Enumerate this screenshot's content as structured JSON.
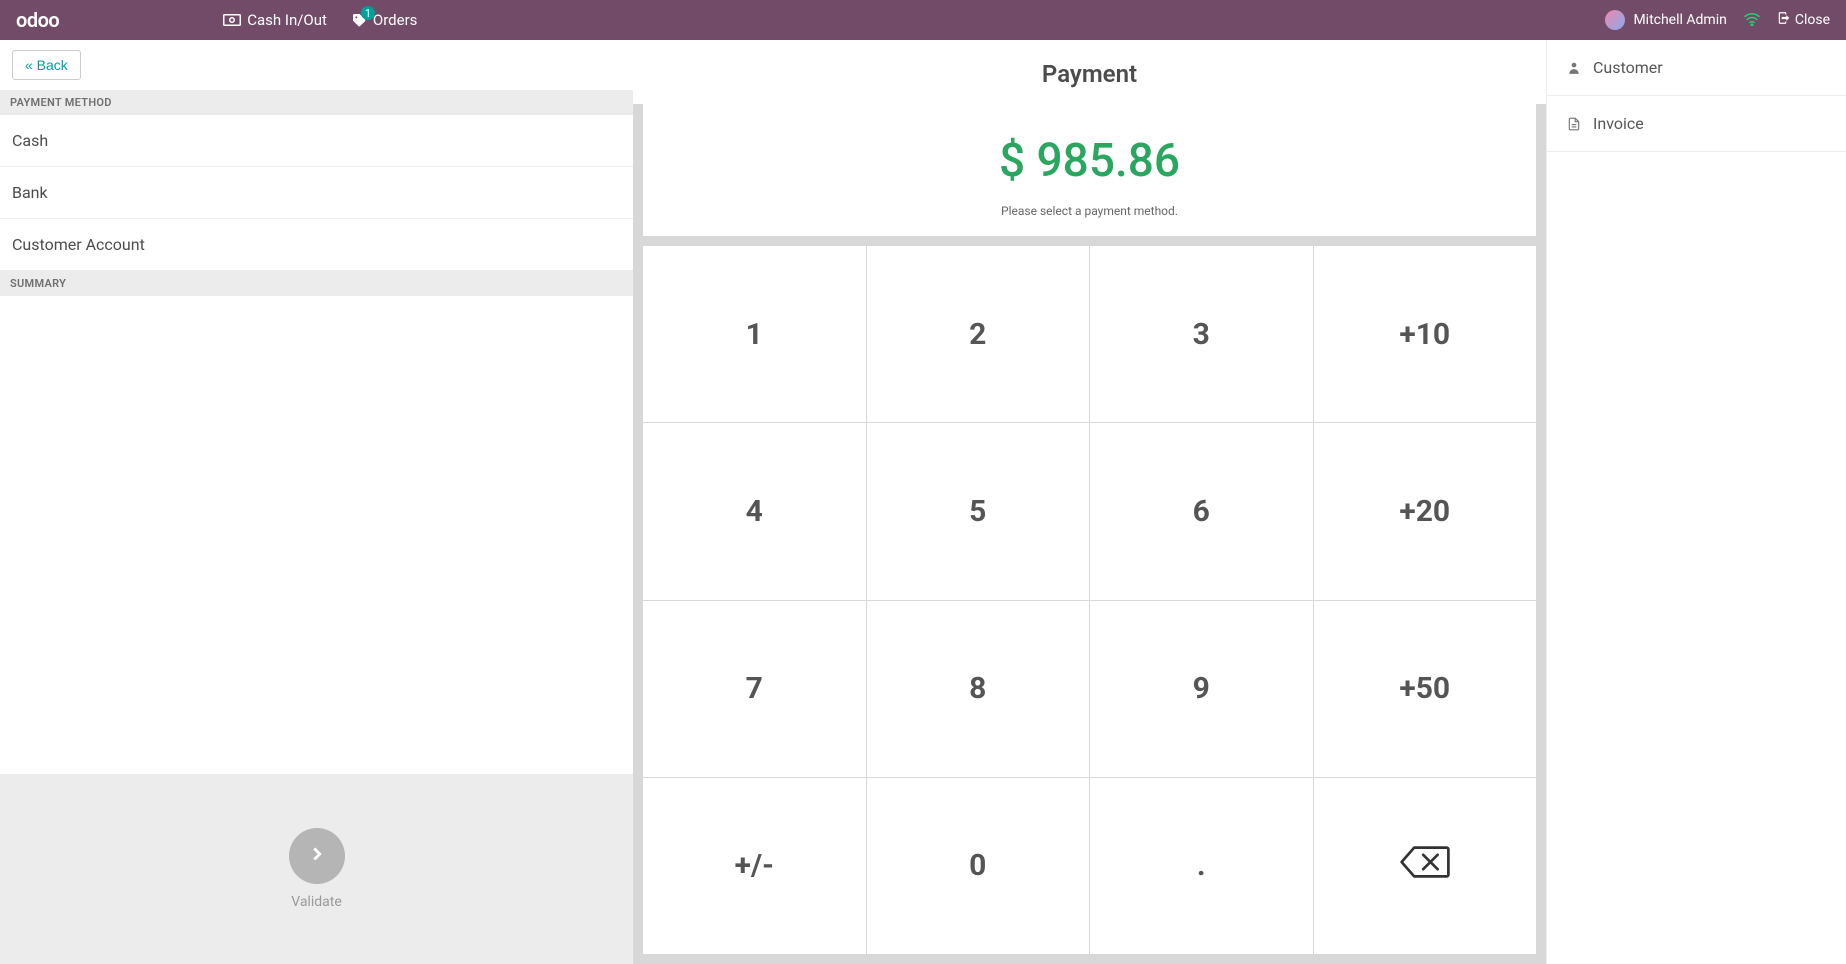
{
  "topbar": {
    "logo": "odoo",
    "cash_in_out": "Cash In/Out",
    "orders": "Orders",
    "orders_badge": "1",
    "user": "Mitchell Admin",
    "close": "Close"
  },
  "left": {
    "back": "« Back",
    "payment_method_header": "PAYMENT METHOD",
    "methods": [
      "Cash",
      "Bank",
      "Customer Account"
    ],
    "summary_header": "SUMMARY",
    "validate": "Validate"
  },
  "center": {
    "title": "Payment",
    "amount": "$ 985.86",
    "hint": "Please select a payment method.",
    "keys": {
      "k1": "1",
      "k2": "2",
      "k3": "3",
      "p10": "+10",
      "k4": "4",
      "k5": "5",
      "k6": "6",
      "p20": "+20",
      "k7": "7",
      "k8": "8",
      "k9": "9",
      "p50": "+50",
      "sign": "+/-",
      "k0": "0",
      "dot": "."
    }
  },
  "right": {
    "customer": "Customer",
    "invoice": "Invoice"
  }
}
